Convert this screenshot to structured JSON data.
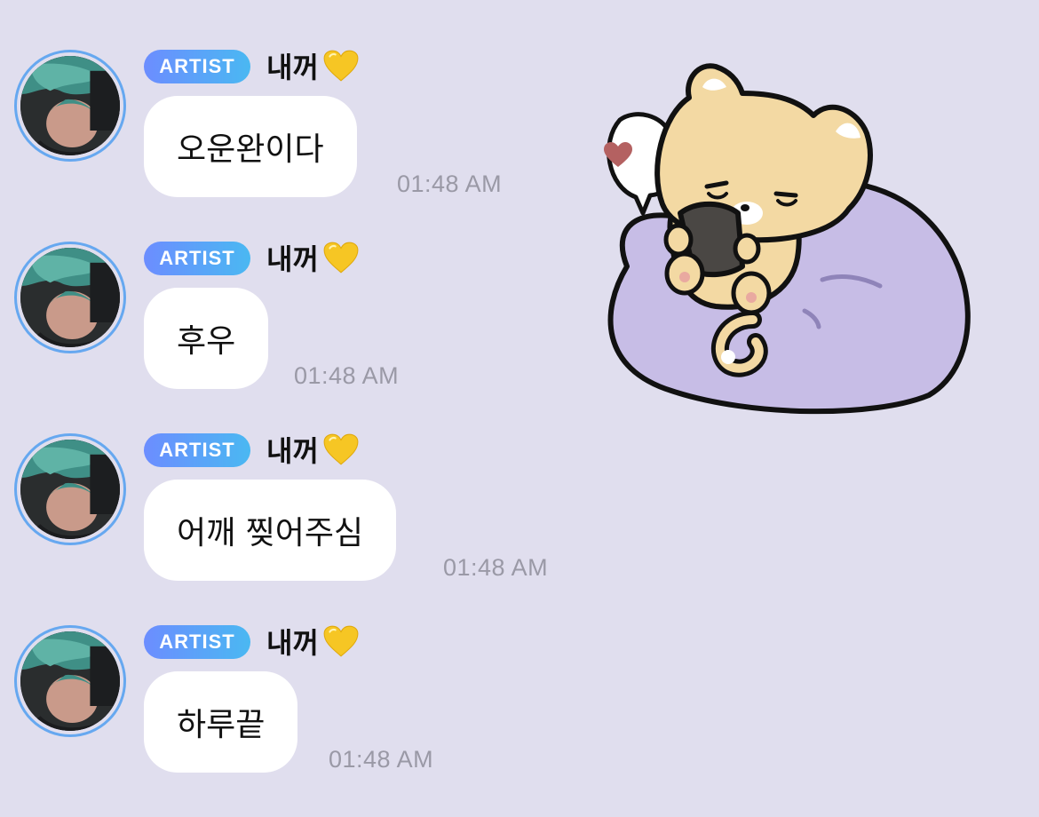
{
  "badge_label": "ARTIST",
  "sender_name": "내꺼",
  "sender_emoji": "yellow-heart-icon",
  "colors": {
    "background": "#e0deee",
    "bubble": "#ffffff",
    "badge_start": "#6c8dff",
    "badge_end": "#4ab8f2",
    "avatar_ring": "#66a8f0",
    "timestamp": "#9a99a6",
    "heart": "#f6c624"
  },
  "messages": [
    {
      "text": "오운완이다",
      "time": "01:48 AM"
    },
    {
      "text": "후우",
      "time": "01:48 AM"
    },
    {
      "text": "어깨 찢어주심",
      "time": "01:48 AM"
    },
    {
      "text": "하루끝",
      "time": "01:48 AM"
    }
  ],
  "sticker": {
    "name": "cat-on-beanbag-sticker"
  }
}
